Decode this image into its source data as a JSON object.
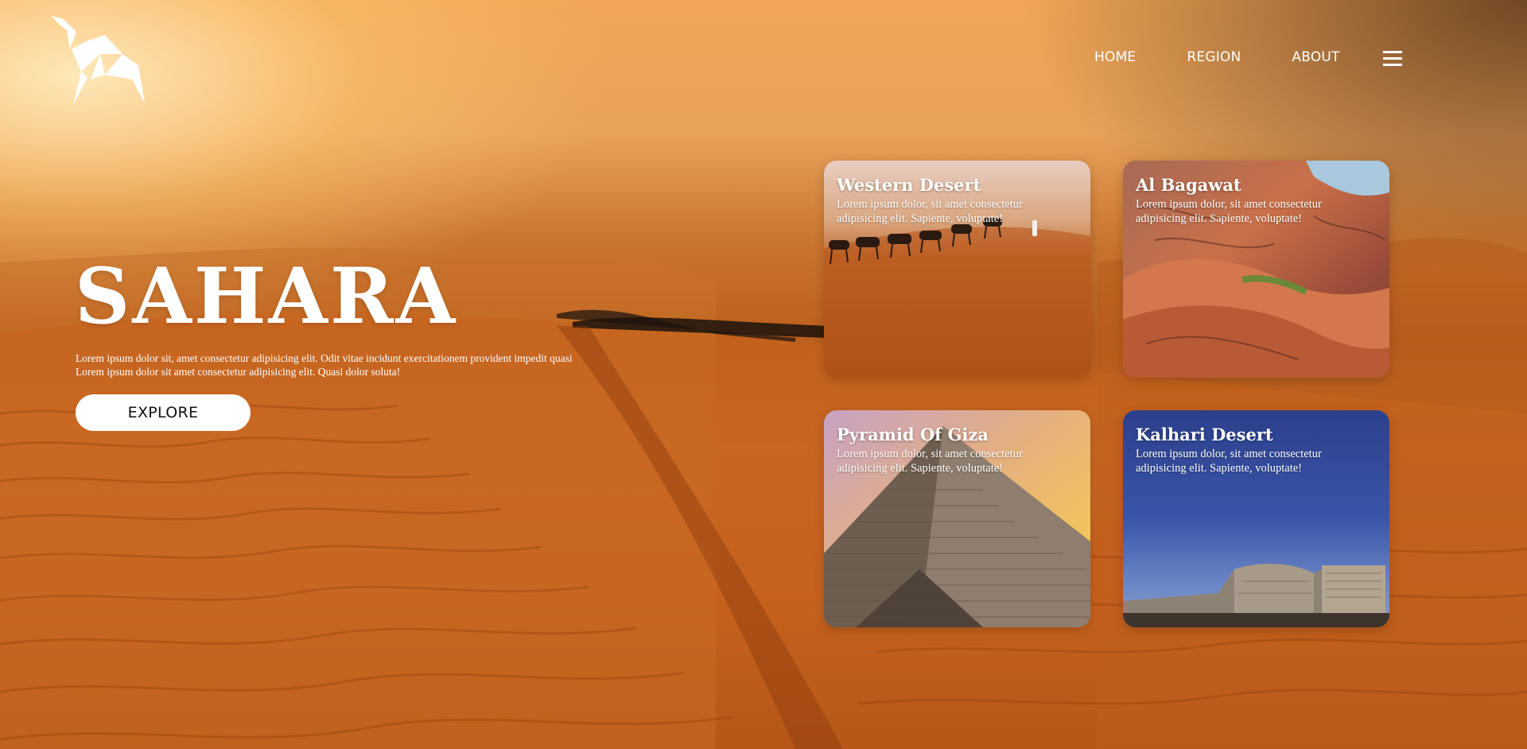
{
  "nav": {
    "items": [
      "HOME",
      "REGION",
      "ABOUT"
    ],
    "menu_icon": "hamburger-menu-icon"
  },
  "logo": {
    "icon": "origami-camel-logo"
  },
  "hero": {
    "title": "SAHARA",
    "description_line1": "Lorem ipsum dolor sit, amet consectetur adipisicing elit. Odit vitae incidunt exercitationem provident impedit quasi",
    "description_line2": "Lorem ipsum dolor sit amet consectetur adipisicing elit. Quasi dolor soluta!",
    "button_label": "EXPLORE"
  },
  "cards": [
    {
      "title": "Western Desert",
      "text": "Lorem ipsum dolor, sit amet consectetur adipisicing elit. Sapiente, voluptate!"
    },
    {
      "title": "Al Bagawat",
      "text": "Lorem ipsum dolor, sit amet consectetur adipisicing elit. Sapiente, voluptate!"
    },
    {
      "title": "Pyramid Of Giza",
      "text": "Lorem ipsum dolor, sit amet consectetur adipisicing elit. Sapiente, voluptate!"
    },
    {
      "title": "Kalhari Desert",
      "text": "Lorem ipsum dolor, sit amet consectetur adipisicing elit. Sapiente, voluptate!"
    }
  ],
  "colors": {
    "sky_light": "#ffe7b8",
    "sand": "#c4611f",
    "button_bg": "#ffffff",
    "text": "#ffffff"
  }
}
